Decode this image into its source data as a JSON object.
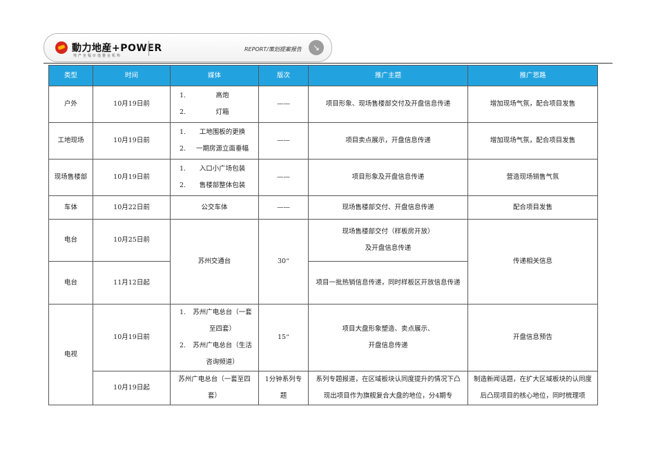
{
  "header": {
    "logo_text": "動力地産+POWER",
    "logo_subtext": "地产全程价值整合机构",
    "report_label": "REPORT/策划提案报告",
    "report_icon": "arrow-down-right-icon"
  },
  "colors": {
    "header_bg": "#22a3df",
    "logo_red": "#d7261e",
    "logo_yellow": "#ffb400"
  },
  "table": {
    "columns": [
      "类型",
      "时间",
      "媒体",
      "版次",
      "推广主题",
      "推广思路"
    ],
    "rows": [
      {
        "type": "户外",
        "time": "10月19日前",
        "media": [
          [
            "1.",
            "高炮"
          ],
          [
            "2.",
            "灯箱"
          ]
        ],
        "edition": "——",
        "theme": "项目形象、现场售楼部交付及开盘信息传递",
        "idea": "增加现场气氛，配合项目发售"
      },
      {
        "type": "工地现场",
        "time": "10月19日前",
        "media": [
          [
            "1.",
            "工地围板的更换"
          ],
          [
            "2.",
            "一期房源立面垂幅"
          ]
        ],
        "edition": "——",
        "theme": "项目卖点展示，开盘信息传递",
        "idea": "增加现场气氛，配合项目发售"
      },
      {
        "type": "现场售楼部",
        "time": "10月19日前",
        "media": [
          [
            "1.",
            "入口小广场包装"
          ],
          [
            "2.",
            "售楼部整体包装"
          ]
        ],
        "edition": "——",
        "theme": "项目形象及开盘信息传递",
        "idea": "营造现场销售气氛"
      },
      {
        "type": "车体",
        "time": "10月22日前",
        "media_single": "公交车体",
        "edition": "——",
        "theme": "现场售楼部交付、开盘信息传递",
        "idea": "配合项目发售"
      },
      {
        "type": "电台",
        "time": "10月25日前",
        "media_single": "苏州交通台",
        "edition": "30“",
        "theme_lines": [
          "现场售楼部交付（样板房开放）",
          "及开盘信息传递"
        ],
        "idea": "传递相关信息"
      },
      {
        "type": "电台",
        "time": "11月12日起",
        "theme": "项目一批热销信息传递，同时样板区开放信息传递"
      },
      {
        "type": "电视",
        "time": "10月19日前",
        "media": [
          [
            "1.",
            "苏州广电总台（一套至四套）"
          ],
          [
            "2.",
            "苏州广电总台（生活咨询频道）"
          ]
        ],
        "edition": "15“",
        "theme_lines": [
          "项目大盘形象塑造、卖点展示、",
          "开盘信息传递"
        ],
        "idea": "开盘信息预告"
      },
      {
        "time": "10月19日起",
        "media_single": "苏州广电总台（一套至四套）",
        "edition": "1分钟系列专题",
        "theme": "系列专题报道，在区域板块认同度提升的情况下凸现出项目作为旗舰复合大盘的地位，分4期专",
        "idea": "制造新闻话题，在扩大区域板块的认同度后凸现项目的核心地位，同时梳理项"
      }
    ]
  }
}
